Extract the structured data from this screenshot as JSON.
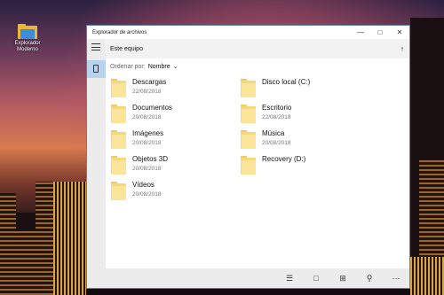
{
  "desktop": {
    "icon_label_line1": "Explorador",
    "icon_label_line2": "Moderno"
  },
  "window": {
    "title": "Explorador de archivos",
    "location": "Este equipo",
    "sort_label": "Ordenar por:",
    "sort_value": "Nombre",
    "items": [
      {
        "name": "Descargas",
        "date": "22/08/2018"
      },
      {
        "name": "Documentos",
        "date": "20/08/2018"
      },
      {
        "name": "Imágenes",
        "date": "20/08/2018"
      },
      {
        "name": "Objetos 3D",
        "date": "20/08/2018"
      },
      {
        "name": "Vídeos",
        "date": "20/08/2018"
      },
      {
        "name": "Disco local (C:)",
        "date": ""
      },
      {
        "name": "Escritorio",
        "date": "22/08/2018"
      },
      {
        "name": "Música",
        "date": "20/08/2018"
      },
      {
        "name": "Recovery (D:)",
        "date": ""
      }
    ]
  },
  "icons": {
    "minimize": "minimize-icon",
    "maximize": "maximize-icon",
    "close": "close-icon",
    "menu": "hamburger-icon",
    "up": "up-arrow-icon"
  },
  "colors": {
    "selection": "#b9d3ee",
    "folder": "#f6d87a"
  }
}
